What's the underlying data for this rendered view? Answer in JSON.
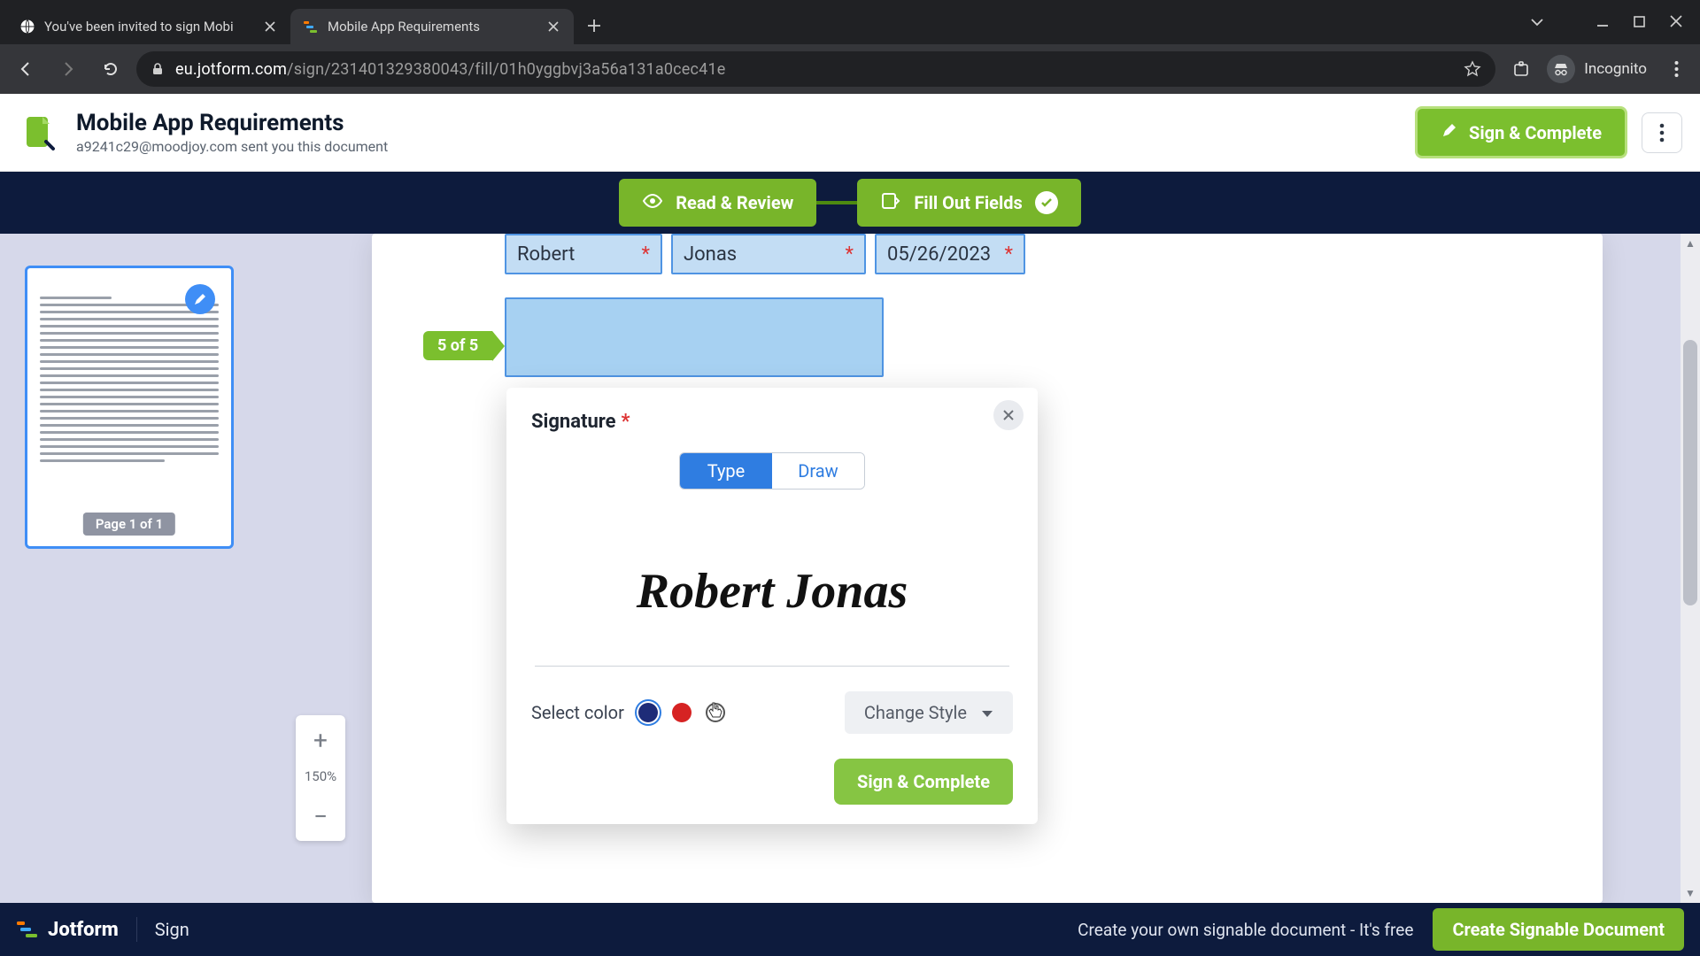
{
  "browser": {
    "tabs": [
      {
        "title": "You've been invited to sign Mobi",
        "active": false
      },
      {
        "title": "Mobile App Requirements",
        "active": true
      }
    ],
    "url_host": "eu.jotform.com",
    "url_path": "/sign/231401329380043/fill/01h0yggbvj3a56a131a0cec41e",
    "incognito_label": "Incognito"
  },
  "header": {
    "title": "Mobile App Requirements",
    "subtitle": "a9241c29@moodjoy.com sent you this document",
    "sign_btn": "Sign & Complete"
  },
  "steps": {
    "read": "Read & Review",
    "fill": "Fill Out Fields"
  },
  "thumbnail": {
    "page_label": "Page 1 of 1"
  },
  "zoom": {
    "level": "150%"
  },
  "fields": {
    "first_name": "Robert",
    "last_name": "Jonas",
    "date": "05/26/2023",
    "counter": "5 of 5"
  },
  "signature": {
    "title": "Signature",
    "tab_type": "Type",
    "tab_draw": "Draw",
    "value": "Robert Jonas",
    "select_color_label": "Select color",
    "change_style": "Change Style",
    "submit": "Sign & Complete",
    "colors": {
      "blue": "#1e2c78",
      "red": "#d62323",
      "black": "#000000"
    }
  },
  "bottom": {
    "brand": "Jotform",
    "sign": "Sign",
    "promo": "Create your own signable document - It's free",
    "cta": "Create Signable Document"
  }
}
